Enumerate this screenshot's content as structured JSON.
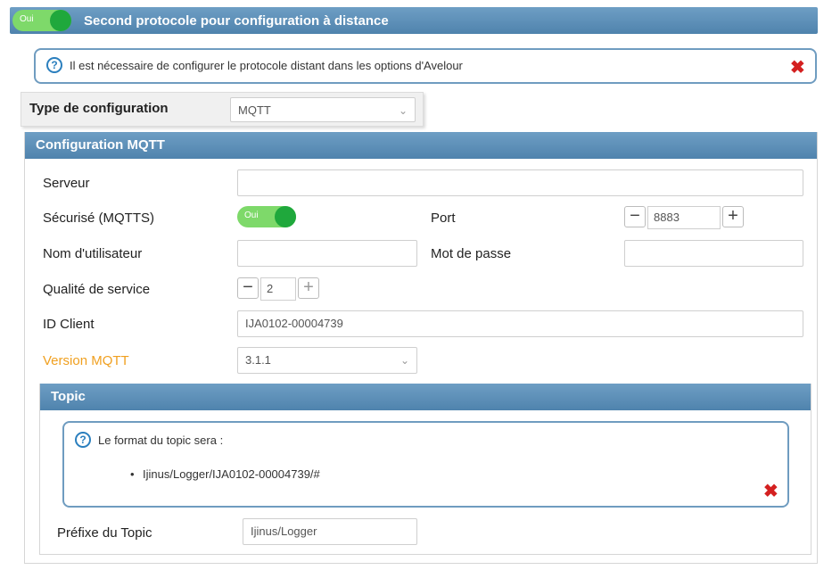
{
  "header": {
    "toggle_label": "Oui",
    "title": "Second protocole pour configuration à distance"
  },
  "notice": {
    "text": "Il est nécessaire de configurer le protocole distant dans les options d'Avelour"
  },
  "type_config": {
    "label": "Type de configuration",
    "value": "MQTT"
  },
  "mqtt_section": {
    "title": "Configuration MQTT",
    "serveur_label": "Serveur",
    "serveur_value": "",
    "securise_label": "Sécurisé (MQTTS)",
    "securise_toggle": "Oui",
    "port_label": "Port",
    "port_value": "8883",
    "user_label": "Nom d'utilisateur",
    "user_value": "",
    "password_label": "Mot de passe",
    "password_value": "",
    "qos_label": "Qualité de service",
    "qos_value": "2",
    "client_id_label": "ID Client",
    "client_id_value": "IJA0102-00004739",
    "version_label": "Version MQTT",
    "version_value": "3.1.1"
  },
  "topic_section": {
    "title": "Topic",
    "info_text": "Le format du topic sera :",
    "topic_format": "Ijinus/Logger/IJA0102-00004739/#",
    "prefix_label": "Préfixe du Topic",
    "prefix_value": "Ijinus/Logger"
  },
  "colors": {
    "header_blue": "#5a8db6",
    "toggle_green": "#1fa83c",
    "warning_orange": "#f0a020",
    "close_red": "#d42020"
  }
}
